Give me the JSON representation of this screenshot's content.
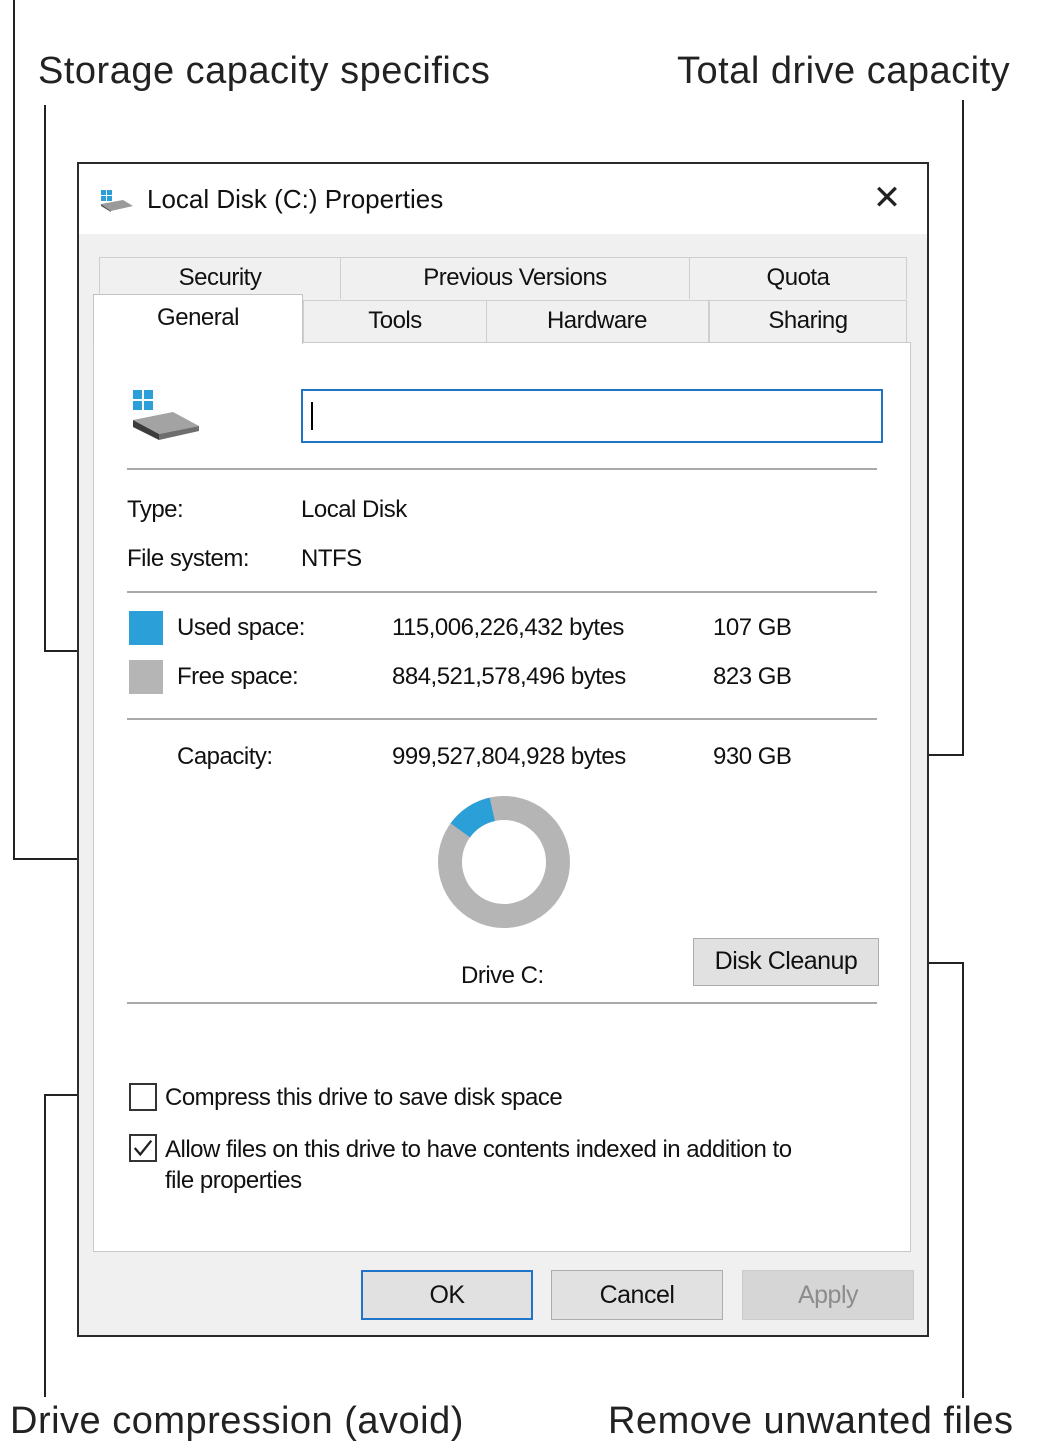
{
  "annotations": {
    "storage_specifics": "Storage capacity specifics",
    "total_capacity": "Total drive capacity",
    "compression": "Drive compression (avoid)",
    "remove_files": "Remove unwanted files"
  },
  "window": {
    "title": "Local Disk (C:) Properties",
    "close_glyph": "✕"
  },
  "tabs": {
    "row_top": [
      "Security",
      "Previous Versions",
      "Quota"
    ],
    "row_bottom": [
      "General",
      "Tools",
      "Hardware",
      "Sharing"
    ],
    "active": "General"
  },
  "general": {
    "drive_name_value": "",
    "type_label": "Type:",
    "type_value": "Local Disk",
    "fs_label": "File system:",
    "fs_value": "NTFS",
    "used_label": "Used space:",
    "used_bytes": "115,006,226,432 bytes",
    "used_size": "107 GB",
    "free_label": "Free space:",
    "free_bytes": "884,521,578,496 bytes",
    "free_size": "823 GB",
    "capacity_label": "Capacity:",
    "capacity_bytes": "999,527,804,928 bytes",
    "capacity_size": "930 GB",
    "used_fraction": 0.115,
    "drive_label": "Drive C:",
    "cleanup_button": "Disk Cleanup",
    "compress_label": "Compress this drive to save disk space",
    "compress_checked": false,
    "index_label_line1": "Allow files on this drive to have contents indexed in addition to",
    "index_label_line2": "file properties",
    "index_checked": true
  },
  "buttons": {
    "ok": "OK",
    "cancel": "Cancel",
    "apply": "Apply"
  },
  "colors": {
    "used": "#2b9fd8",
    "free": "#b5b5b5",
    "accent": "#1f73c9"
  },
  "icons": {
    "title_icon": "drive-icon",
    "panel_icon": "windows-drive-icon"
  }
}
